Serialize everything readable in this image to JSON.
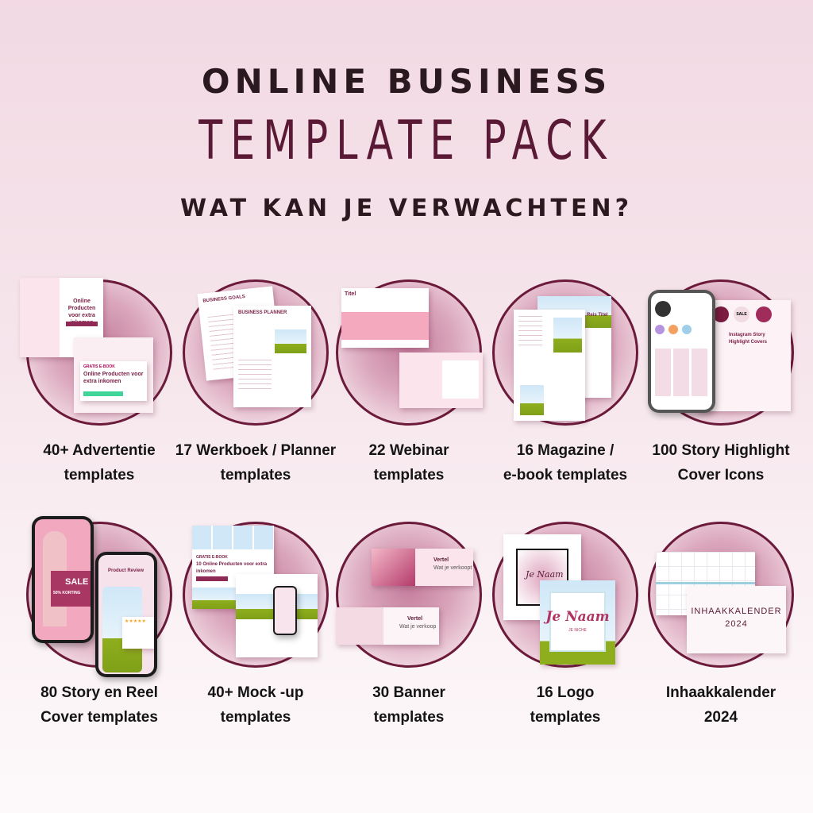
{
  "header": {
    "line1": "ONLINE BUSINESS",
    "line2": "TEMPLATE PACK",
    "line3": "WAT KAN JE VERWACHTEN?"
  },
  "colors": {
    "title": "#5a1a35",
    "ring": "#6b1a3a",
    "accent": "#8e2a55",
    "background": "#f2d9e3"
  },
  "items": [
    {
      "line1": "40+ Advertentie",
      "line2": "templates",
      "thumb": {
        "badge": "GRATIS E-BOOK",
        "title": "Online Producten voor extra inkomen"
      }
    },
    {
      "line1": "17 Werkboek / Planner",
      "line2": "templates",
      "thumb": {
        "title": "BUSINESS PLANNER",
        "back_title": "BUSINESS GOALS"
      }
    },
    {
      "line1": "22 Webinar",
      "line2": "templates",
      "thumb": {
        "title": "Titel"
      }
    },
    {
      "line1": "16 Magazine /",
      "line2": "e-book  templates",
      "thumb": {
        "title": "Reis Titel"
      }
    },
    {
      "line1": "100 Story Highlight",
      "line2": "Cover Icons",
      "thumb": {
        "title": "Instagram Story Highlight Covers",
        "icon": "SALE"
      }
    },
    {
      "line1": "80 Story en Reel",
      "line2": "Cover templates",
      "thumb": {
        "sale": "SALE",
        "discount": "50% KORTING",
        "review": "Product Review",
        "stars": "★★★★★"
      }
    },
    {
      "line1": "40+ Mock -up",
      "line2": "templates",
      "thumb": {
        "badge": "GRATIS E-BOOK",
        "title": "10 Online Producten voor extra inkomen"
      }
    },
    {
      "line1": "30 Banner",
      "line2": "templates",
      "thumb": {
        "title": "Vertel",
        "subtitle": "Wat je verkoopt",
        "subtitle2": "Wat je verkoop"
      }
    },
    {
      "line1": "16 Logo",
      "line2": "templates",
      "thumb": {
        "name": "Je Naam",
        "niche": "JE NICHE"
      }
    },
    {
      "line1": "Inhaakkalender",
      "line2": "2024",
      "thumb": {
        "title": "INHAAKKALENDER",
        "year": "2024"
      }
    }
  ]
}
